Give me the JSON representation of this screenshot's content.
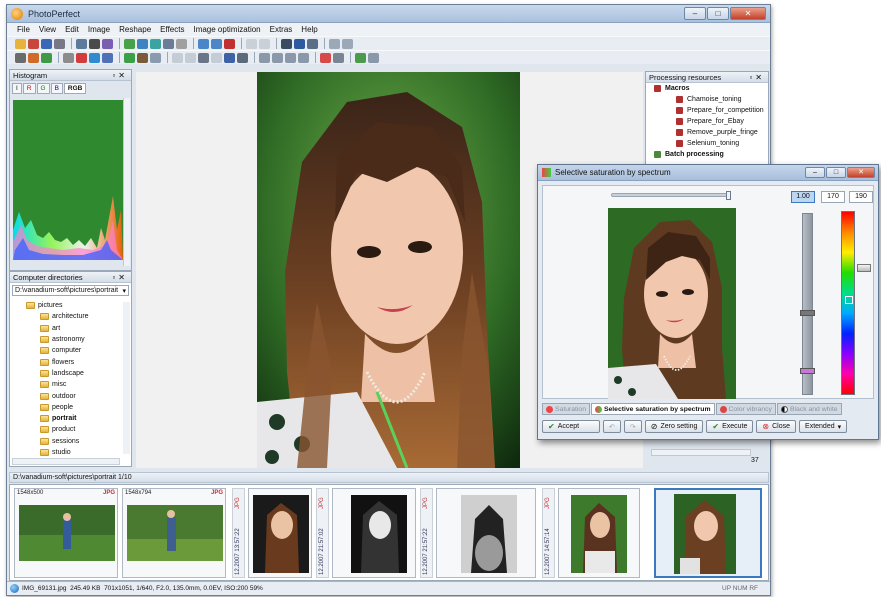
{
  "window": {
    "title": "PhotoPerfect",
    "min": "–",
    "max": "□",
    "close": "✕"
  },
  "menu": [
    "File",
    "View",
    "Edit",
    "Image",
    "Reshape",
    "Effects",
    "Image optimization",
    "Extras",
    "Help"
  ],
  "histogram": {
    "title": "Histogram",
    "tabs": [
      "I",
      "R",
      "G",
      "B",
      "RGB"
    ],
    "active_tab": "RGB",
    "colors": {
      "plot_bg": "#2f8a2f"
    }
  },
  "directories": {
    "title": "Computer directories",
    "path": "D:\\vanadium-soft\\pictures\\portrait",
    "root": "pictures",
    "folders": [
      "architecture",
      "art",
      "astronomy",
      "computer",
      "flowers",
      "landscape",
      "misc",
      "outdoor",
      "people",
      "portrait",
      "product",
      "sessions",
      "studio"
    ],
    "selected": "portrait"
  },
  "resources": {
    "title": "Processing resources",
    "macros_label": "Macros",
    "macros": [
      "Chamoise_toning",
      "Prepare_for_competition",
      "Prepare_for_Ebay",
      "Remove_purple_fringe",
      "Selenium_toning"
    ],
    "batch_label": "Batch processing",
    "scroll_value": "37"
  },
  "dialog": {
    "title": "Selective saturation by spectrum",
    "values": [
      "1.00",
      "170",
      "190"
    ],
    "tabs": [
      "Saturation",
      "Selective saturation by spectrum",
      "Color vibrancy",
      "Black and white"
    ],
    "active_tab": "Selective saturation by spectrum",
    "buttons": {
      "accept": "Accept",
      "zero": "Zero setting",
      "execute": "Execute",
      "close": "Close",
      "extended": "Extended"
    }
  },
  "filmstrip": {
    "path": "D:\\vanadium-soft\\pictures\\portrait 1/10",
    "thumbs": [
      {
        "size": "1548x500",
        "fmt": "JPG"
      },
      {
        "size": "1548x794",
        "fmt": "JPG"
      }
    ],
    "vlabels": [
      {
        "text": "12.2007 13:57:22",
        "fmt": "JPG"
      },
      {
        "text": "12.2007 21:57:02",
        "fmt": "JPG"
      },
      {
        "text": "12.2007 21:57:22",
        "fmt": "JPG"
      },
      {
        "text": "12.2007 14:57:14",
        "fmt": "JPG"
      }
    ]
  },
  "status": {
    "file": "IMG_69131.jpg",
    "size": "245.49 KB",
    "info": "701x1051, 1/640, F2.0, 135.0mm, 0.0EV, ISO:200",
    "zoom": "59%",
    "right": "UP NUM RF"
  }
}
